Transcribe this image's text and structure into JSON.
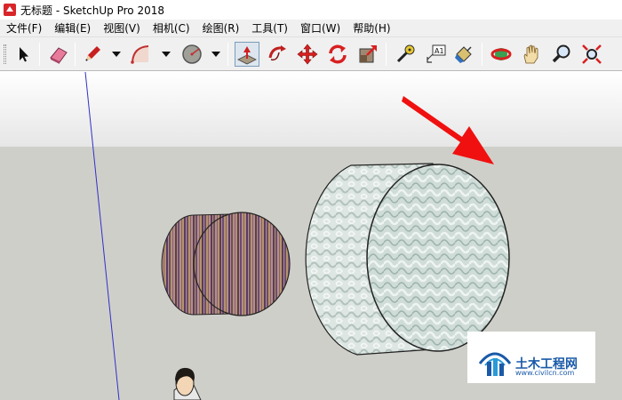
{
  "window": {
    "title": "无标题 - SketchUp Pro 2018"
  },
  "menu": [
    "文件(F)",
    "编辑(E)",
    "视图(V)",
    "相机(C)",
    "绘图(R)",
    "工具(T)",
    "窗口(W)",
    "帮助(H)"
  ],
  "toolbar": {
    "tools": [
      {
        "name": "select-tool",
        "icon": "arrow-cursor-icon"
      },
      {
        "name": "eraser-tool",
        "icon": "eraser-icon"
      },
      {
        "name": "pencil-tool",
        "icon": "pencil-icon"
      },
      {
        "name": "arc-tool",
        "icon": "arc-icon"
      },
      {
        "name": "circle-tool",
        "icon": "circle-icon"
      },
      {
        "name": "push-pull-tool",
        "icon": "push-pull-icon"
      },
      {
        "name": "follow-me-tool",
        "icon": "follow-me-icon"
      },
      {
        "name": "move-tool",
        "icon": "move-icon"
      },
      {
        "name": "rotate-tool",
        "icon": "rotate-icon"
      },
      {
        "name": "scale-tool",
        "icon": "scale-icon"
      },
      {
        "name": "tape-measure-tool",
        "icon": "tape-measure-icon"
      },
      {
        "name": "text-tool",
        "icon": "text-label-icon",
        "label": "A1"
      },
      {
        "name": "paint-bucket-tool",
        "icon": "paint-bucket-icon"
      },
      {
        "name": "orbit-tool",
        "icon": "orbit-icon"
      },
      {
        "name": "pan-tool",
        "icon": "hand-icon"
      },
      {
        "name": "zoom-tool",
        "icon": "magnifier-icon"
      },
      {
        "name": "zoom-extents-tool",
        "icon": "zoom-extents-icon"
      }
    ],
    "active": "push-pull-tool"
  },
  "watermark": {
    "brand": "土木工程网",
    "url": "www.civilcn.com"
  },
  "colors": {
    "sky": "#ebebeb",
    "ground": "#cfcfca",
    "arrow": "#f01010",
    "axis": "#3030c8",
    "brand": "#1a5aa8"
  }
}
